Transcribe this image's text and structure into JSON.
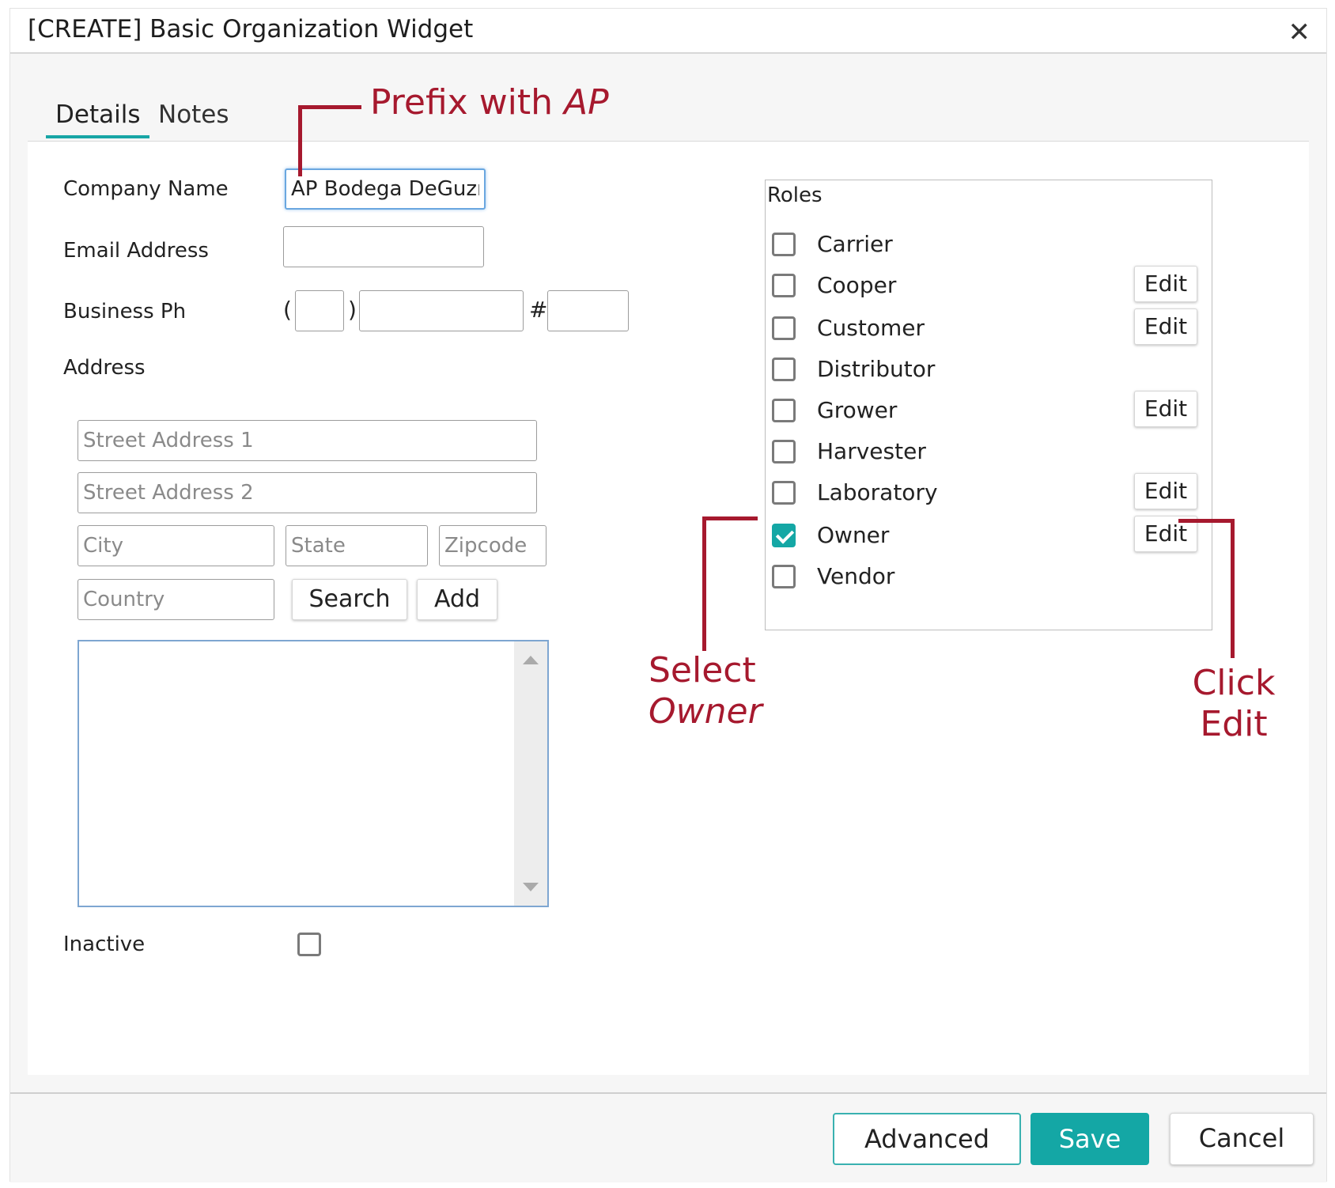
{
  "dialog": {
    "title": "[CREATE] Basic Organization Widget",
    "close_glyph": "✕"
  },
  "tabs": [
    {
      "label": "Details",
      "active": true
    },
    {
      "label": "Notes",
      "active": false
    }
  ],
  "form": {
    "company_name_label": "Company Name",
    "company_name_value": "AP Bodega DeGuzr",
    "email_label": "Email Address",
    "email_value": "",
    "phone_label": "Business Ph",
    "phone_open_paren": "(",
    "phone_close_paren": ")",
    "phone_hash": "#",
    "address_label": "Address",
    "street1_placeholder": "Street Address 1",
    "street2_placeholder": "Street Address 2",
    "city_placeholder": "City",
    "state_placeholder": "State",
    "zip_placeholder": "Zipcode",
    "country_placeholder": "Country",
    "search_button": "Search",
    "add_button": "Add",
    "inactive_label": "Inactive",
    "inactive_checked": false
  },
  "roles": {
    "title": "Roles",
    "edit_label": "Edit",
    "items": [
      {
        "label": "Carrier",
        "checked": false,
        "has_edit": false
      },
      {
        "label": "Cooper",
        "checked": false,
        "has_edit": true
      },
      {
        "label": "Customer",
        "checked": false,
        "has_edit": true
      },
      {
        "label": "Distributor",
        "checked": false,
        "has_edit": false
      },
      {
        "label": "Grower",
        "checked": false,
        "has_edit": true
      },
      {
        "label": "Harvester",
        "checked": false,
        "has_edit": false
      },
      {
        "label": "Laboratory",
        "checked": false,
        "has_edit": true
      },
      {
        "label": "Owner",
        "checked": true,
        "has_edit": true
      },
      {
        "label": "Vendor",
        "checked": false,
        "has_edit": false
      }
    ]
  },
  "footer": {
    "advanced_button": "Advanced",
    "save_button": "Save",
    "cancel_button": "Cancel"
  },
  "annotations": {
    "prefix_text": "Prefix with ",
    "prefix_emph": "AP",
    "select_text": "Select",
    "select_emph": "Owner",
    "click_line1": "Click",
    "click_line2": "Edit"
  },
  "colors": {
    "accent": "#14a7a5",
    "annotation": "#a6192e"
  }
}
